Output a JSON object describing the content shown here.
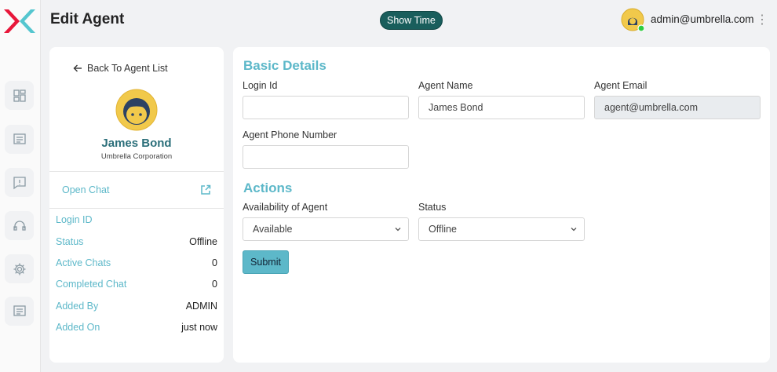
{
  "header": {
    "title": "Edit Agent",
    "show_time_label": "Show Time",
    "user_email": "admin@umbrella.com",
    "kebab": "⋮"
  },
  "sidebar": {
    "items": [
      {
        "icon": "dashboard-icon"
      },
      {
        "icon": "chat-icon"
      },
      {
        "icon": "alert-message-icon"
      },
      {
        "icon": "support-headset-icon"
      },
      {
        "icon": "gear-icon"
      },
      {
        "icon": "message-list-icon"
      }
    ]
  },
  "agent_card": {
    "back_label": "Back To Agent List",
    "name": "James Bond",
    "organization": "Umbrella Corporation",
    "open_chat_label": "Open Chat",
    "details": [
      {
        "key": "Login ID",
        "value": ""
      },
      {
        "key": "Status",
        "value": "Offline"
      },
      {
        "key": "Active Chats",
        "value": "0"
      },
      {
        "key": "Completed Chat",
        "value": "0"
      },
      {
        "key": "Added By",
        "value": "ADMIN"
      },
      {
        "key": "Added On",
        "value": "just now"
      }
    ]
  },
  "form": {
    "basic_title": "Basic Details",
    "login_id_label": "Login Id",
    "login_id_value": "",
    "agent_name_label": "Agent Name",
    "agent_name_value": "James Bond",
    "agent_email_label": "Agent Email",
    "agent_email_value": "agent@umbrella.com",
    "phone_label": "Agent Phone Number",
    "phone_value": "",
    "actions_title": "Actions",
    "availability_label": "Availability of Agent",
    "availability_value": "Available",
    "status_label": "Status",
    "status_value": "Offline",
    "submit_label": "Submit"
  },
  "colors": {
    "accent": "#5db8c9",
    "show_time_bg": "#195e5c",
    "logo_red": "#e8173a",
    "logo_teal": "#55c6cf",
    "avatar_yellow": "#f1c94b",
    "avatar_navy": "#2d4263"
  }
}
